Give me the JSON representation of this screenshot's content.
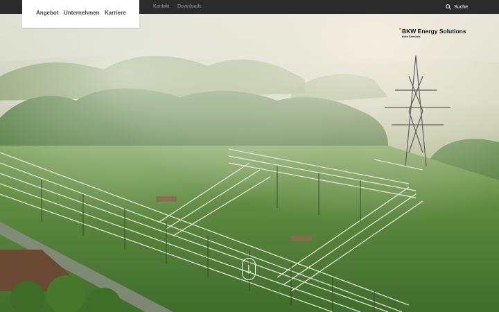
{
  "topbar": {
    "links": [
      "Kontakt",
      "Downloads"
    ],
    "search_label": "Suche"
  },
  "nav": {
    "items": [
      "Angebot",
      "Unternehmen",
      "Karriere"
    ]
  },
  "logo": {
    "name": "BKW Energy Solutions",
    "sub": "Infra Services"
  },
  "hero": {
    "image": "aerial-electrical-substation-in-fog"
  },
  "scroll": {
    "icon": "arrow-down-icon"
  },
  "colors": {
    "topbar": "#2b2b2b",
    "accent": "#f39200",
    "nav_bg": "#ffffff",
    "nav_text": "#444444"
  }
}
